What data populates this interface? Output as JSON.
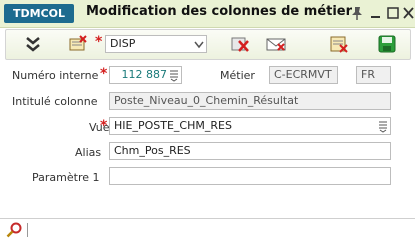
{
  "window": {
    "badge": "TDMCOL",
    "title": "Modification des colonnes de métier"
  },
  "toolbar": {
    "mode_value": "DISP",
    "icons": [
      "expand-down-icon",
      "open-record-icon",
      "delete-icon",
      "mail-icon",
      "clear-form-icon",
      "save-icon"
    ]
  },
  "form": {
    "numero_label": "Numéro interne",
    "numero_value": "112 887",
    "metier_label": "Métier",
    "metier_value": "C-ECRMVT",
    "lang_value": "FR",
    "intitule_label": "Intitulé colonne",
    "intitule_value": "Poste_Niveau_0_Chemin_Résultat",
    "vue_label": "Vue",
    "vue_value": "HIE_POSTE_CHM_RES",
    "alias_label": "Alias",
    "alias_value": "Chm_Pos_RES",
    "param1_label": "Paramètre 1",
    "param1_value": ""
  },
  "colors": {
    "title_bar": "#eaf2d4",
    "badge": "#1d6b8f",
    "required": "#d42020"
  }
}
